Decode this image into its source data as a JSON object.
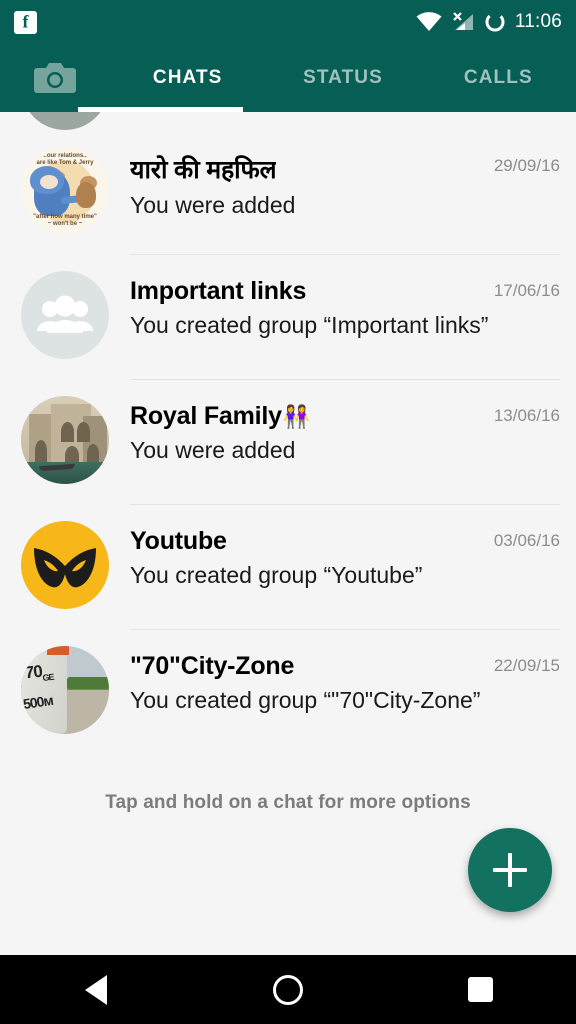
{
  "status_bar": {
    "notification_icon": "facebook-icon",
    "wifi_icon": "wifi-icon",
    "signal_icon": "cellular-signal-off-icon",
    "sync_icon": "sync-circle-icon",
    "time": "11:06"
  },
  "toolbar": {
    "camera_icon": "camera-icon",
    "tabs": [
      {
        "label": "CHATS",
        "active": true
      },
      {
        "label": "STATUS",
        "active": false
      },
      {
        "label": "CALLS",
        "active": false
      }
    ]
  },
  "chats": [
    {
      "name": "",
      "emoji": "",
      "message": "",
      "date": "",
      "avatar": "partial-photo-avatar",
      "partial": true
    },
    {
      "name": "यारो की महफिल",
      "emoji": "",
      "message": "You were added",
      "date": "29/09/16",
      "avatar": "tom-and-jerry-photo-avatar"
    },
    {
      "name": "Important links",
      "emoji": "",
      "message": "You created group “Important links”",
      "date": "17/06/16",
      "avatar": "default-group-avatar"
    },
    {
      "name": "Royal Family",
      "emoji": "👭",
      "message": "You were added",
      "date": "13/06/16",
      "avatar": "fort-photo-avatar"
    },
    {
      "name": "Youtube",
      "emoji": "",
      "message": "You created group “Youtube”",
      "date": "03/06/16",
      "avatar": "yellow-mask-avatar"
    },
    {
      "name": "\"70\"City-Zone",
      "emoji": "",
      "message": "You created group “\"70\"City-Zone”",
      "date": "22/09/15",
      "avatar": "milestone-photo-avatar"
    }
  ],
  "hint": "Tap and hold on a chat for more options",
  "fab": {
    "icon": "plus-icon",
    "label": "+"
  },
  "nav_bar": {
    "back_icon": "back-triangle-icon",
    "home_icon": "home-circle-icon",
    "recents_icon": "recents-square-icon"
  },
  "colors": {
    "primary": "#075E54",
    "fab": "#12715F",
    "list_bg": "#F5F5F5",
    "date_text": "#8D8D8D",
    "hint_text": "#7C7C7C",
    "accent_yellow": "#F7B718"
  }
}
